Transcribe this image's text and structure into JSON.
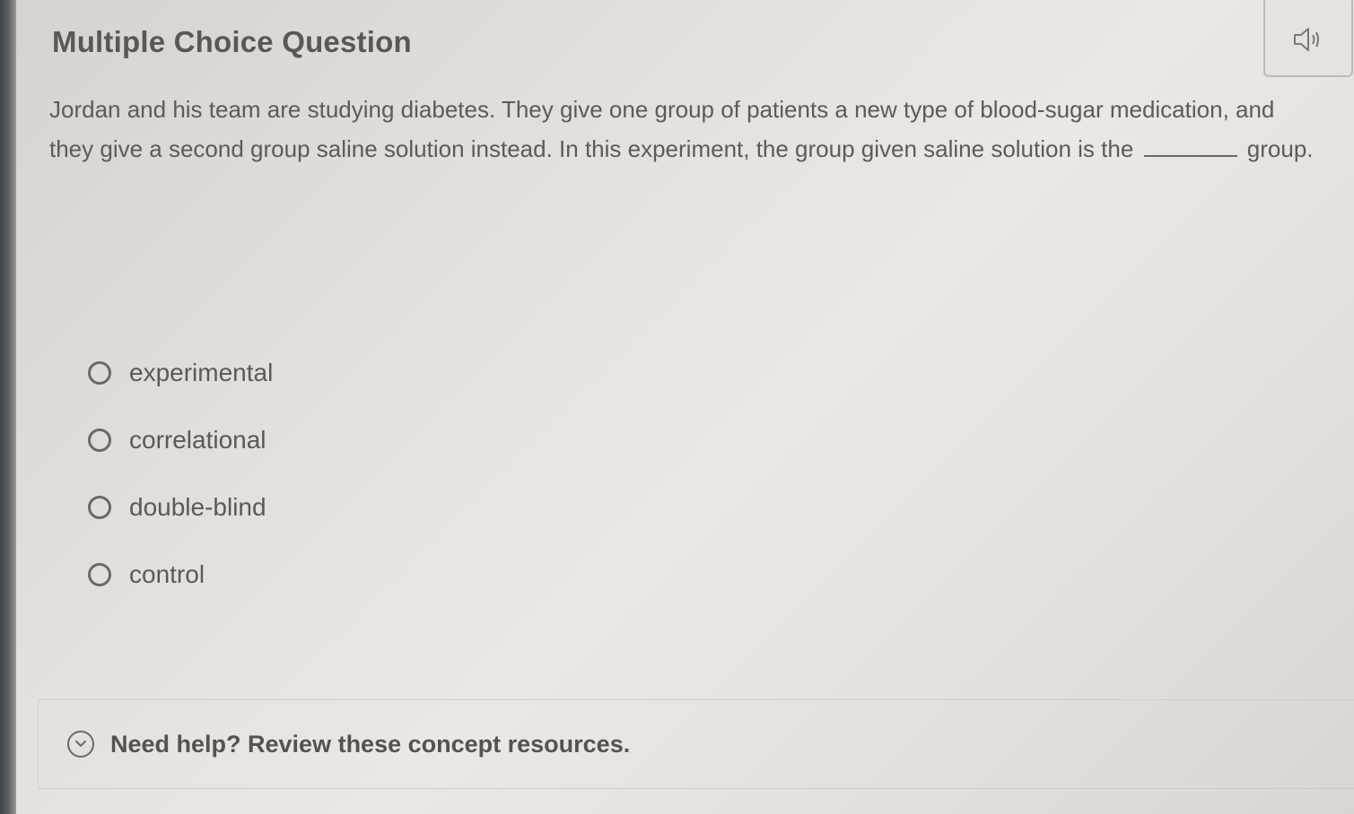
{
  "question": {
    "type_label": "Multiple Choice Question",
    "text_before_blank": "Jordan and his team are studying diabetes. They give one group of patients a new type of blood-sugar medication, and they give a second group saline solution instead. In this experiment, the group given saline solution is the",
    "text_after_blank": "group.",
    "audio_icon": "speaker-icon"
  },
  "options": [
    {
      "label": "experimental",
      "selected": false
    },
    {
      "label": "correlational",
      "selected": false
    },
    {
      "label": "double-blind",
      "selected": false
    },
    {
      "label": "control",
      "selected": false
    }
  ],
  "help": {
    "label": "Need help? Review these concept resources.",
    "icon": "chevron-down-icon"
  }
}
